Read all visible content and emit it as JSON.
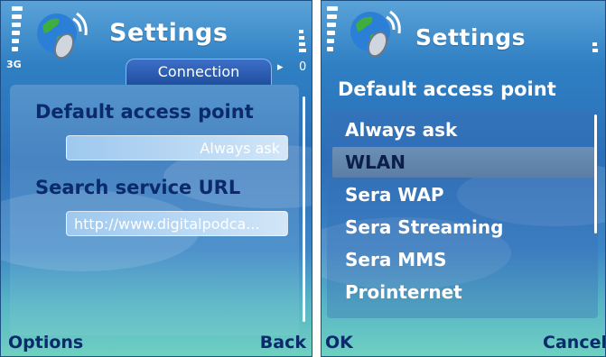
{
  "screen1": {
    "title": "Settings",
    "network_label": "3G",
    "tab_label": "Connection",
    "tab_arrow": "▸",
    "battery_indicator": "0",
    "fields": [
      {
        "label": "Default access point",
        "value": "Always ask"
      },
      {
        "label": "Search service URL",
        "value": "http://www.digitalpodca..."
      }
    ],
    "softkeys": {
      "left": "Options",
      "right": "Back"
    }
  },
  "screen2": {
    "title": "Settings",
    "list_title": "Default access point",
    "items": [
      "Always ask",
      "WLAN",
      "Sera WAP",
      "Sera Streaming",
      "Sera MMS",
      "Prointernet"
    ],
    "selected_index": 1,
    "softkeys": {
      "left": "OK",
      "right": "Cancel"
    }
  },
  "icons": {
    "app_icon": "globe-satellite-icon",
    "signal": "signal-strength-icon",
    "battery": "battery-level-icon"
  },
  "colors": {
    "accent_dark_text": "#0b2a6b",
    "screen_top": "#5aa3d8",
    "screen_bottom": "#6fd0c2"
  }
}
